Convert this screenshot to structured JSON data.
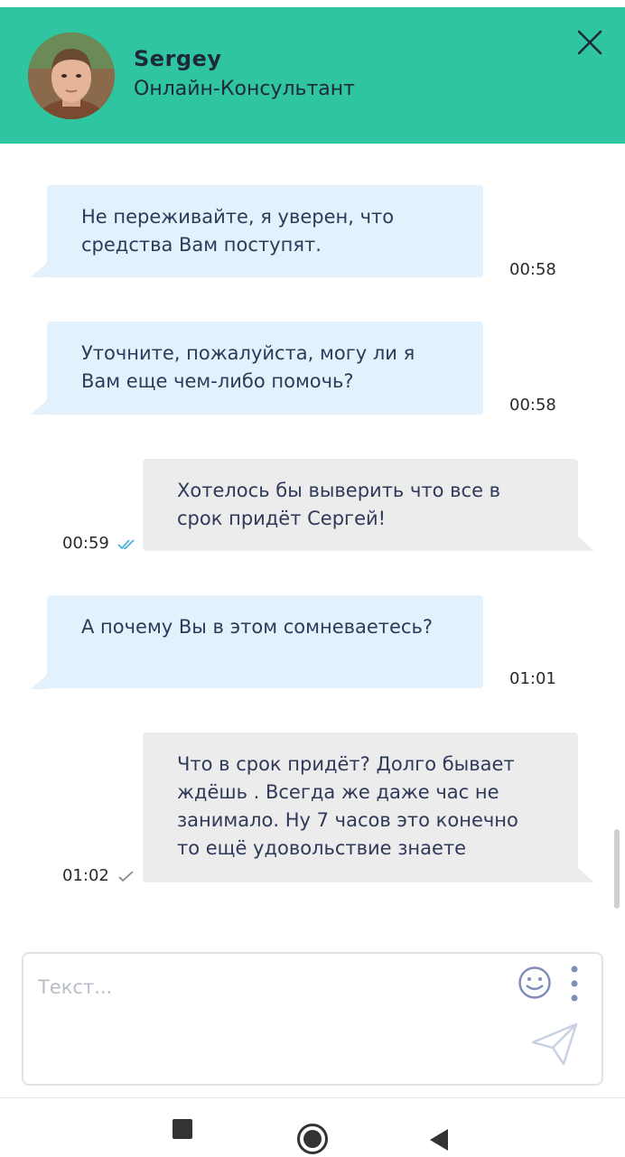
{
  "colors": {
    "accent": "#2fc5a0",
    "incoming_bubble": "#e3f1fc",
    "outgoing_bubble": "#ececec",
    "read_tick": "#4fb3d9"
  },
  "header": {
    "name": "Sergey",
    "role": "Онлайн-Консультант",
    "close_icon": "close-icon"
  },
  "messages": [
    {
      "direction": "in",
      "text": "Не переживайте, я уверен, что средства Вам поступят.",
      "time": "00:58"
    },
    {
      "direction": "in",
      "text": "Уточните, пожалуйста, могу ли я Вам еще чем-либо помочь?",
      "time": "00:58"
    },
    {
      "direction": "out",
      "text": "Хотелось бы выверить что все в срок придёт Сергей!",
      "time": "00:59",
      "status": "read"
    },
    {
      "direction": "in",
      "text": "А почему Вы в этом сомневаетесь?",
      "time": "01:01"
    },
    {
      "direction": "out",
      "text": "Что в срок придёт? Долго бывает ждёшь . Всегда же даже час не занимало. Ну 7 часов это конечно то ещё удовольствие знаете",
      "time": "01:02",
      "status": "sent"
    }
  ],
  "composer": {
    "placeholder": "Текст...",
    "value": "",
    "emoji_icon": "emoji-icon",
    "menu_icon": "more-vertical-icon",
    "send_icon": "send-icon"
  },
  "navbar": {
    "items": [
      "recents-square-icon",
      "home-circle-icon",
      "back-triangle-icon"
    ]
  }
}
